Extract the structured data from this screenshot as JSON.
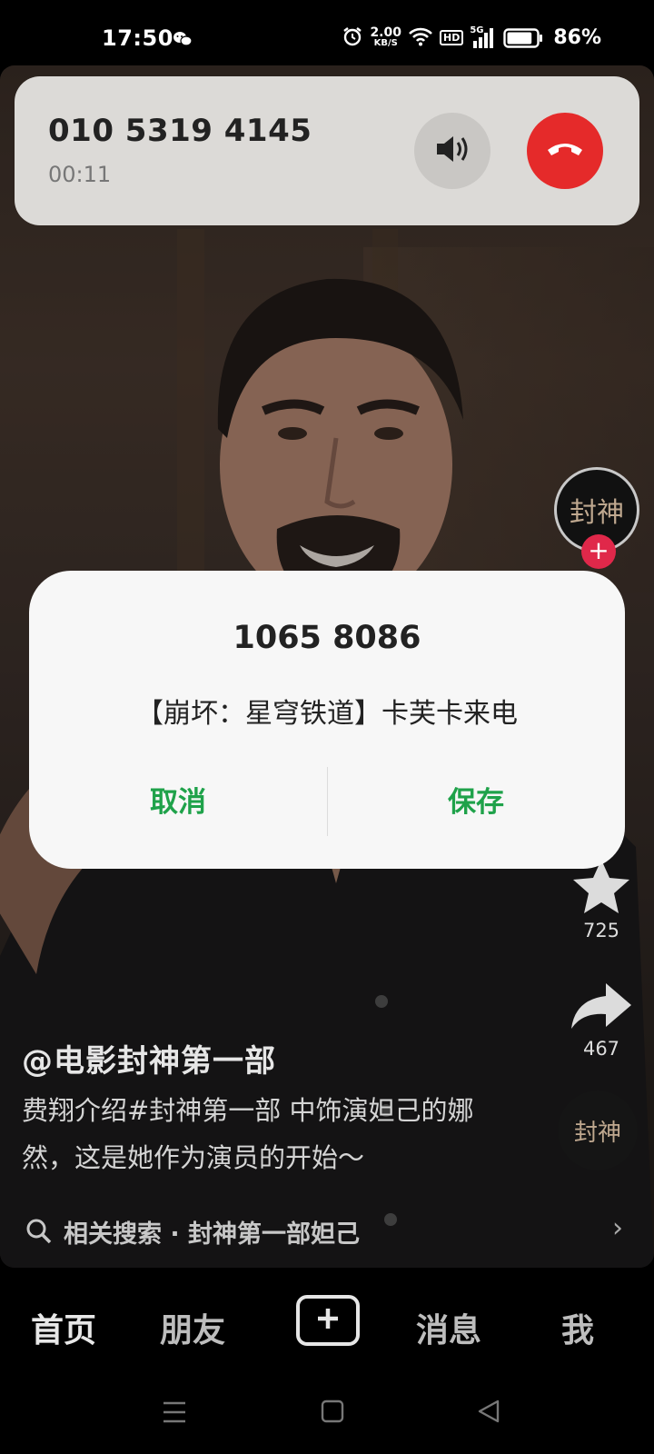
{
  "status_bar": {
    "time": "17:50",
    "network_speed_value": "2.00",
    "network_speed_unit": "KB/S",
    "hd_label": "HD",
    "signal_label": "5G",
    "battery_percent": "86%",
    "battery_level": 0.86
  },
  "call": {
    "number": "010 5319 4145",
    "duration": "00:11"
  },
  "dialog": {
    "title": "1065 8086",
    "message": "【崩坏：星穹铁道】卡芙卡来电",
    "cancel_label": "取消",
    "save_label": "保存"
  },
  "video": {
    "creator_avatar_text": "封神",
    "favorites_count": "725",
    "shares_count": "467",
    "music_disc_text": "封神",
    "author": "@电影封神第一部",
    "description": "费翔介绍#封神第一部 中饰演妲己的娜然，这是她作为演员的开始～",
    "related_search": "相关搜索 · 封神第一部妲己"
  },
  "nav": {
    "home": "首页",
    "friends": "朋友",
    "messages": "消息",
    "me": "我"
  },
  "colors": {
    "accent_green": "#1fa24a",
    "hangup_red": "#e52a2a",
    "follow_pink": "#e0284a"
  }
}
